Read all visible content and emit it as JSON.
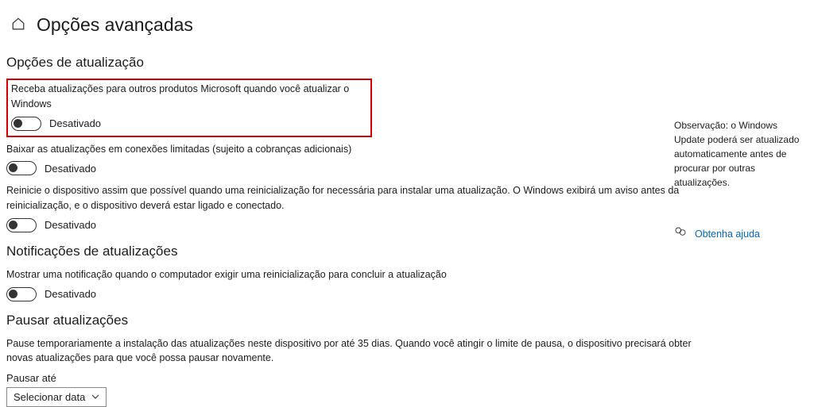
{
  "header": {
    "title": "Opções avançadas"
  },
  "sections": {
    "update_options": {
      "title": "Opções de atualização",
      "items": [
        {
          "desc": "Receba atualizações para outros produtos Microsoft quando você atualizar o Windows",
          "state": "Desativado"
        },
        {
          "desc": "Baixar as atualizações em conexões limitadas (sujeito a cobranças adicionais)",
          "state": "Desativado"
        },
        {
          "desc": "Reinicie o dispositivo assim que possível quando uma reinicialização for necessária para instalar uma atualização. O Windows exibirá um aviso antes da reinicialização, e o dispositivo deverá estar ligado e conectado.",
          "state": "Desativado"
        }
      ]
    },
    "notifications": {
      "title": "Notificações de atualizações",
      "item": {
        "desc": "Mostrar uma notificação quando o computador exigir uma reinicialização para concluir a atualização",
        "state": "Desativado"
      }
    },
    "pause": {
      "title": "Pausar atualizações",
      "desc": "Pause temporariamente a instalação das atualizações neste dispositivo por até 35 dias. Quando você atingir o limite de pausa, o dispositivo precisará obter novas atualizações para que você possa pausar novamente.",
      "select_label": "Pausar até",
      "select_value": "Selecionar data"
    }
  },
  "sidebar": {
    "note": "Observação: o Windows Update poderá ser atualizado automaticamente antes de procurar por outras atualizações.",
    "help": "Obtenha ajuda"
  }
}
